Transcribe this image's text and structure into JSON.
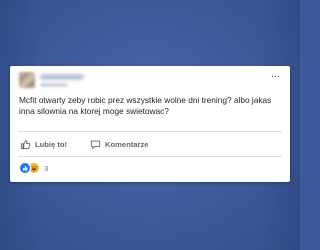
{
  "post": {
    "text": "Mcfit otwarty zeby robic prez wszystkie wolne dni trening? albo jakas inna silownia na ktorej moge swietowac?",
    "more_icon": "ellipsis-icon",
    "more_label": "..."
  },
  "actions": {
    "like_label": "Lubię to!",
    "like_icon": "thumbs-up-icon",
    "comment_label": "Komentarze",
    "comment_icon": "speech-bubble-icon"
  },
  "reactions": {
    "count": "3",
    "icons": [
      "like-reaction-icon",
      "haha-reaction-icon"
    ]
  },
  "colors": {
    "background": "#3b5998",
    "card": "#ffffff",
    "text": "#1d2129",
    "secondary_text": "#606770",
    "like_blue": "#1877f2",
    "haha_yellow": "#f7b125"
  }
}
